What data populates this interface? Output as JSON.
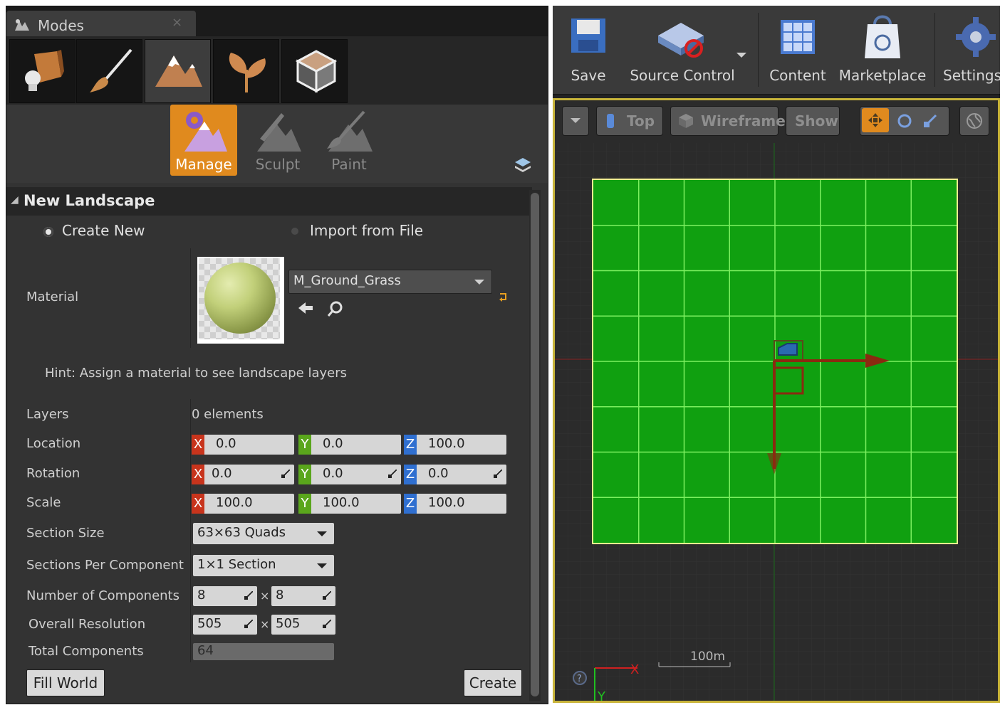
{
  "modes_panel": {
    "tab_title": "Modes",
    "tab_close": "×",
    "mode_buttons": [
      {
        "name": "place-mode",
        "icon": "place-icon"
      },
      {
        "name": "paint-mode",
        "icon": "brush-icon"
      },
      {
        "name": "landscape-mode",
        "icon": "mountain-icon",
        "active": true
      },
      {
        "name": "foliage-mode",
        "icon": "leaf-icon"
      },
      {
        "name": "geometry-mode",
        "icon": "cube-icon"
      }
    ],
    "tools": {
      "manage_label": "Manage",
      "sculpt_label": "Sculpt",
      "paint_label": "Paint"
    },
    "section_title": "New Landscape",
    "source": {
      "create_new": "Create New",
      "import_from_file": "Import from File"
    },
    "material": {
      "label": "Material",
      "value": "M_Ground_Grass"
    },
    "hint": "Hint: Assign a material to see landscape layers",
    "layers": {
      "label": "Layers",
      "value": "0 elements"
    },
    "location": {
      "label": "Location",
      "x": "0.0",
      "y": "0.0",
      "z": "100.0"
    },
    "rotation": {
      "label": "Rotation",
      "x": "0.0",
      "y": "0.0",
      "z": "0.0"
    },
    "scale": {
      "label": "Scale",
      "x": "100.0",
      "y": "100.0",
      "z": "100.0"
    },
    "axis_labels": {
      "x": "X",
      "y": "Y",
      "z": "Z"
    },
    "section_size": {
      "label": "Section Size",
      "value": "63×63 Quads"
    },
    "sections_per_component": {
      "label": "Sections Per Component",
      "value": "1×1 Section"
    },
    "number_of_components": {
      "label": "Number of Components",
      "x": "8",
      "y": "8"
    },
    "overall_resolution": {
      "label": "Overall Resolution",
      "x": "505",
      "y": "505"
    },
    "total_components": {
      "label": "Total Components",
      "value": "64"
    },
    "times_sign": "×",
    "fill_world_label": "Fill World",
    "create_label": "Create"
  },
  "toolbar": {
    "items": [
      {
        "label": "Save",
        "icon": "floppy-disk-icon"
      },
      {
        "label": "Source Control",
        "icon": "source-control-icon"
      },
      {
        "label": "Content",
        "icon": "content-browser-icon"
      },
      {
        "label": "Marketplace",
        "icon": "marketplace-bag-icon"
      },
      {
        "label": "Settings",
        "icon": "gear-icon"
      }
    ]
  },
  "viewport": {
    "view_label": "Top",
    "wireframe_label": "Wireframe",
    "show_label": "Show",
    "scale_label": "100m",
    "axis_x": "X",
    "axis_y": "Y",
    "landscape_color": "#10a010",
    "grid_line_color": "#7cf060",
    "grid_cells": 8
  }
}
